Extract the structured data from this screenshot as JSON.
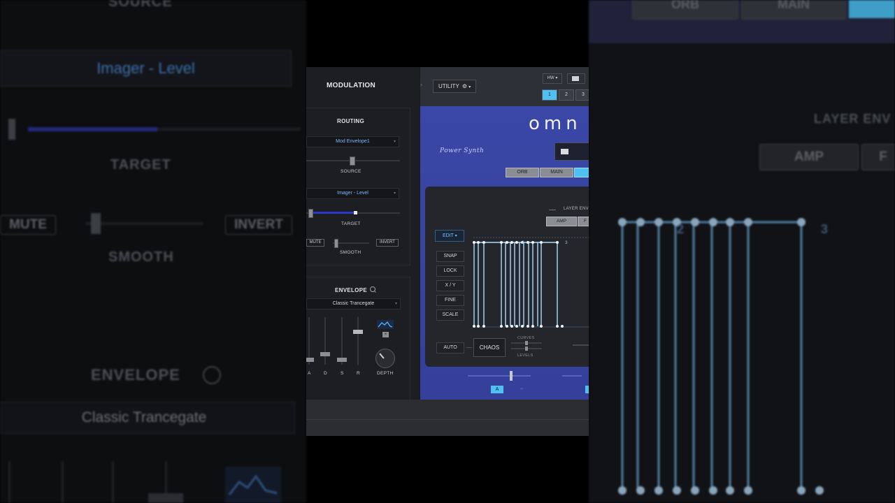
{
  "modulation": {
    "title": "MODULATION",
    "routing": {
      "title": "ROUTING",
      "source_value": "Mod Envelope1",
      "source_label": "SOURCE",
      "target_value": "Imager - Level",
      "target_label": "TARGET",
      "target_amount": 0.6,
      "mute_label": "MUTE",
      "invert_label": "INVERT",
      "smooth_label": "SMOOTH"
    },
    "envelope": {
      "title": "ENVELOPE",
      "preset": "Classic Trancegate",
      "slider_labels": [
        "A",
        "D",
        "S",
        "R"
      ],
      "slider_levels": [
        0.1,
        0.2,
        0.1,
        0.7
      ],
      "depth_label": "DEPTH"
    }
  },
  "synth": {
    "utility_label": "UTILITY",
    "hw_label": "HW",
    "page_numbers": [
      "1",
      "2",
      "3"
    ],
    "active_page": "1",
    "logo_text": "omn",
    "brand": "Power Synth",
    "tabs": [
      "ORB",
      "MAIN"
    ],
    "layer_env_label": "LAYER ENV",
    "amp_label": "AMP",
    "f_label": "F",
    "edit_label": "EDIT",
    "side_buttons": [
      "SNAP",
      "LOCK",
      "X / Y",
      "FINE",
      "SCALE"
    ],
    "auto_label": "AUTO",
    "chaos_label": "CHAOS",
    "curves_label": "CURVES",
    "levels_label": "LEVELS",
    "point_labels": [
      "2",
      "3"
    ],
    "layer_label": "A"
  },
  "background": {
    "left": {
      "source": "SOURCE",
      "target_value": "Imager - Level",
      "target": "TARGET",
      "mute": "MUTE",
      "invert": "INVERT",
      "smooth": "SMOOTH",
      "envelope": "ENVELOPE",
      "preset": "Classic Trancegate"
    },
    "right": {
      "orb": "ORB",
      "main": "MAIN",
      "layer_env": "LAYER ENV",
      "amp": "AMP",
      "f": "F",
      "n2": "2",
      "n3": "3"
    }
  },
  "colors": {
    "accent": "#4fc0f0",
    "panel_blue": "#3b47a6",
    "link": "#7fb8ff",
    "bar": "#8fd0ff"
  }
}
